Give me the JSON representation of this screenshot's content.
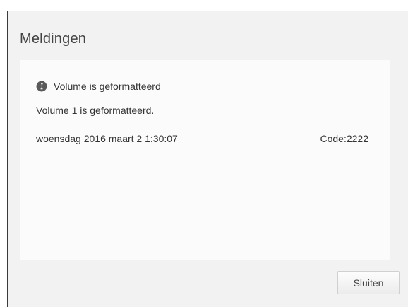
{
  "dialog": {
    "title": "Meldingen",
    "alert": {
      "icon": "info-icon",
      "title": "Volume is geformatteerd",
      "message": "Volume 1 is geformatteerd.",
      "datetime": "woensdag 2016 maart 2 1:30:07",
      "code": "Code:2222"
    },
    "close_label": "Sluiten"
  },
  "colors": {
    "dialog_background": "#f2f2f2",
    "panel_background": "#fbfbfb",
    "text": "#333333",
    "icon": "#5a5a5a"
  }
}
